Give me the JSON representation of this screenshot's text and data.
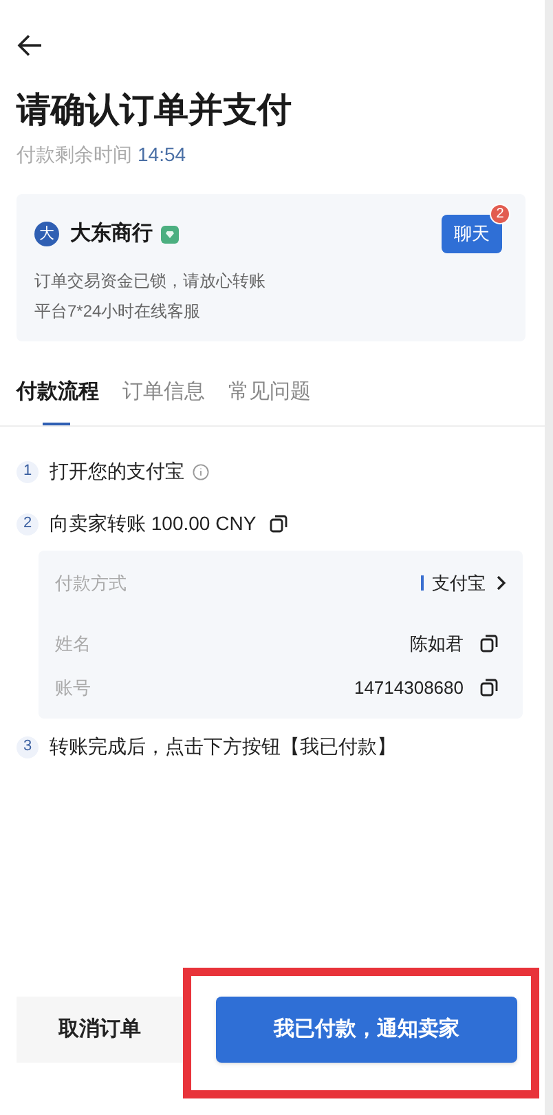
{
  "title": "请确认订单并支付",
  "timer": {
    "label": "付款剩余时间",
    "value": "14:54"
  },
  "merchant": {
    "avatar": "大",
    "name": "大东商行",
    "verified": true,
    "chat_button": "聊天",
    "badge": "2",
    "lines": [
      "订单交易资金已锁，请放心转账",
      "平台7*24小时在线客服"
    ]
  },
  "tabs": [
    {
      "label": "付款流程",
      "selected": true
    },
    {
      "label": "订单信息",
      "selected": false
    },
    {
      "label": "常见问题",
      "selected": false
    }
  ],
  "steps": [
    {
      "number": "1",
      "text": "打开您的支付宝",
      "kind": "info"
    },
    {
      "number": "2",
      "text": "向卖家转账 100.00 CNY",
      "kind": "copy"
    },
    {
      "number": "3",
      "text": "转账完成后，点击下方按钮【我已付款】",
      "kind": "plain"
    }
  ],
  "payment_details": [
    {
      "label": "付款方式",
      "value": "支付宝",
      "kind": "select"
    },
    {
      "label": "姓名",
      "value": "陈如君",
      "kind": "copy"
    },
    {
      "label": "账号",
      "value": "14714308680",
      "kind": "copy"
    }
  ],
  "buttons": {
    "cancel": "取消订单",
    "confirm": "我已付款，通知卖家"
  },
  "highlight": true
}
